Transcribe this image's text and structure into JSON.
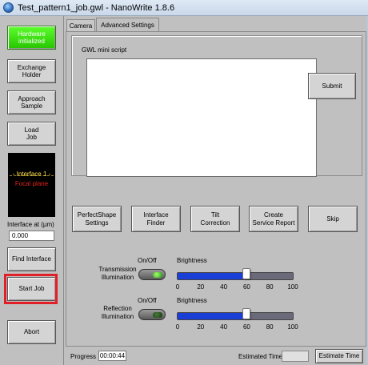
{
  "window": {
    "title": "Test_pattern1_job.gwl - NanoWrite 1.8.6",
    "app_icon": "globe-icon"
  },
  "left_panel": {
    "buttons": [
      {
        "id": "hardware",
        "label": "Hardware\ninitialized",
        "status": "active",
        "color": "#3fe01c"
      },
      {
        "id": "exchange",
        "label": "Exchange\nHolder"
      },
      {
        "id": "approach",
        "label": "Approach\nSample"
      },
      {
        "id": "load",
        "label": "Load\nJob"
      },
      {
        "id": "find_interface",
        "label": "Find Interface"
      },
      {
        "id": "start_job",
        "label": "Start Job",
        "highlighted": true,
        "highlight_color": "#e21f26"
      },
      {
        "id": "abort",
        "label": "Abort"
      }
    ],
    "interface_display": {
      "line1": "- Interface 1 -",
      "line2": "Focal plane"
    },
    "interface_at_label": "Interface at (µm)",
    "interface_at_value": "0.000"
  },
  "tabs": [
    {
      "label": "Camera",
      "active": false
    },
    {
      "label": "Advanced Settings",
      "active": true
    }
  ],
  "gwl_script": {
    "title": "GWL mini script",
    "content": "",
    "submit_label": "Submit"
  },
  "action_buttons": [
    {
      "label": "PerfectShape\nSettings"
    },
    {
      "label": "Interface\nFinder"
    },
    {
      "label": "Tilt\nCorrection"
    },
    {
      "label": "Create\nService Report"
    },
    {
      "label": "Skip"
    }
  ],
  "illumination": {
    "transmission": {
      "label": "Transmission\nIllumination",
      "onoff_label": "On/Off",
      "on": true,
      "brightness_label": "Brightness",
      "brightness": 60,
      "scale": [
        "0",
        "20",
        "40",
        "60",
        "80",
        "100"
      ]
    },
    "reflection": {
      "label": "Reflection\nIllumination",
      "onoff_label": "On/Off",
      "on": false,
      "brightness_label": "Brightness",
      "brightness": 60,
      "scale": [
        "0",
        "20",
        "40",
        "60",
        "80",
        "100"
      ]
    },
    "slider_color": "#1a3fd6"
  },
  "status": {
    "progress_label": "Progress",
    "progress_value": "00:00:44",
    "estimated_label": "Estimated Time",
    "estimated_value": "",
    "estimate_button": "Estimate Time"
  }
}
